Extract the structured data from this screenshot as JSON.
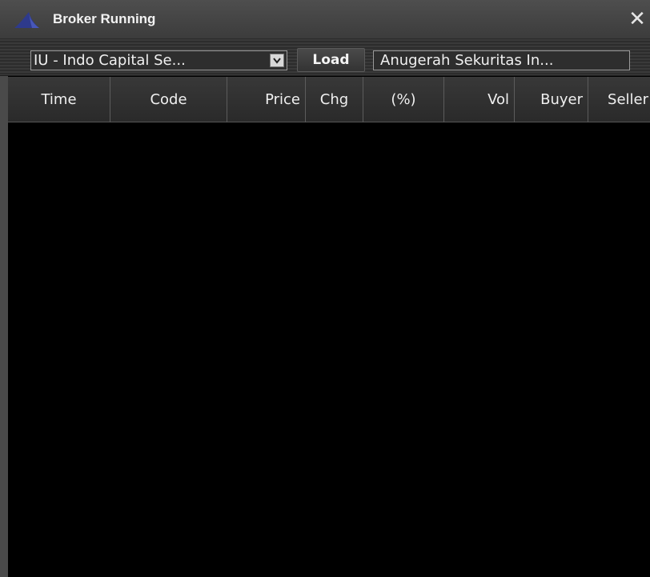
{
  "window": {
    "title": "Broker Running",
    "close_symbol": "✕"
  },
  "toolbar": {
    "broker_select_value": "IU - Indo Capital Se...",
    "dropdown_arrow": "⌄",
    "load_label": "Load",
    "broker_name_value": "Anugerah Sekuritas In..."
  },
  "table": {
    "columns": [
      "Time",
      "Code",
      "Price",
      "Chg",
      "(%)",
      "Vol",
      "Buyer",
      "Seller"
    ],
    "rows": []
  },
  "icons": {
    "app": "shark-fin-logo-icon",
    "close": "close-icon",
    "dropdown": "chevron-down-icon"
  },
  "colors": {
    "titlebar": "#444444",
    "background": "#000000",
    "logo": "#2e3a8c"
  }
}
